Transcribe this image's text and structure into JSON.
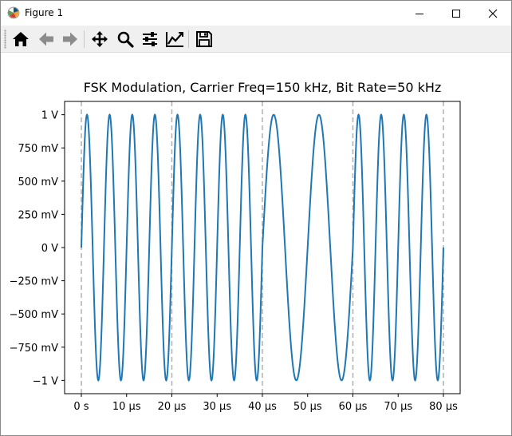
{
  "window": {
    "title": "Figure 1",
    "icons": {
      "app": "matplotlib-icon",
      "minimize": "minimize-icon",
      "maximize": "maximize-icon",
      "close": "close-icon"
    }
  },
  "toolbar": {
    "tools": [
      "home-icon",
      "back-arrow-icon",
      "forward-arrow-icon",
      "pan-icon",
      "zoom-icon",
      "configure-subplots-icon",
      "edit-axis-icon",
      "save-icon"
    ]
  },
  "chart_data": {
    "type": "line",
    "title": "FSK Modulation, Carrier Freq=150 kHz, Bit Rate=50 kHz",
    "xlabel": "",
    "ylabel": "",
    "x_unit": "µs",
    "xlim": [
      -3.7,
      83.7
    ],
    "ylim": [
      -1.1,
      1.1
    ],
    "xticks": [
      0,
      10,
      20,
      30,
      40,
      50,
      60,
      70,
      80
    ],
    "xtick_labels": [
      "0 s",
      "10 µs",
      "20 µs",
      "30 µs",
      "40 µs",
      "50 µs",
      "60 µs",
      "70 µs",
      "80 µs"
    ],
    "yticks": [
      1,
      0.75,
      0.5,
      0.25,
      0,
      -0.25,
      -0.5,
      -0.75,
      -1
    ],
    "ytick_labels": [
      "1 V",
      "750 mV",
      "500 mV",
      "250 mV",
      "0 V",
      "−250 mV",
      "−500 mV",
      "−750 mV",
      "−1 V"
    ],
    "bit_boundaries_us": [
      0,
      20,
      40,
      60,
      80
    ],
    "segments": [
      {
        "start_us": 0,
        "end_us": 20,
        "frequency_khz": 200
      },
      {
        "start_us": 20,
        "end_us": 40,
        "frequency_khz": 200
      },
      {
        "start_us": 40,
        "end_us": 60,
        "frequency_khz": 100
      },
      {
        "start_us": 60,
        "end_us": 80,
        "frequency_khz": 200
      }
    ],
    "series": [
      {
        "color": "#1f77b4",
        "amplitude_v": 1
      }
    ],
    "boundary_line_color": "#b0b0b0",
    "grid": false,
    "legend": "none"
  }
}
